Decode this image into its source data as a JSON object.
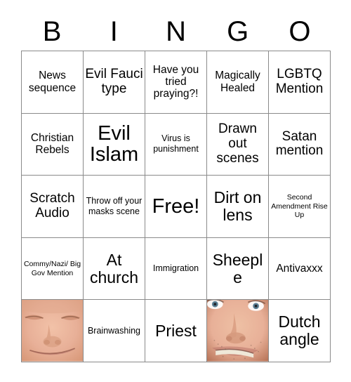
{
  "card": {
    "header_letters": [
      "B",
      "I",
      "N",
      "G",
      "O"
    ],
    "free_space_label": "Free!",
    "grid": [
      [
        {
          "text": "News sequence",
          "size": "md",
          "type": "text"
        },
        {
          "text": "Evil Fauci type",
          "size": "lg",
          "type": "text"
        },
        {
          "text": "Have you tried praying?!",
          "size": "md",
          "type": "text"
        },
        {
          "text": "Magically Healed",
          "size": "md",
          "type": "text"
        },
        {
          "text": "LGBTQ Mention",
          "size": "lg",
          "type": "text"
        }
      ],
      [
        {
          "text": "Christian Rebels",
          "size": "md",
          "type": "text"
        },
        {
          "text": "Evil Islam",
          "size": "xxl",
          "type": "text"
        },
        {
          "text": "Virus is punishment",
          "size": "sm",
          "type": "text"
        },
        {
          "text": "Drawn out scenes",
          "size": "lg",
          "type": "text"
        },
        {
          "text": "Satan mention",
          "size": "lg",
          "type": "text"
        }
      ],
      [
        {
          "text": "Scratch Audio",
          "size": "lg",
          "type": "text"
        },
        {
          "text": "Throw off your masks scene",
          "size": "sm",
          "type": "text"
        },
        {
          "text": "Free!",
          "size": "xxl",
          "type": "free"
        },
        {
          "text": "Dirt on lens",
          "size": "xl",
          "type": "text"
        },
        {
          "text": "Second Amendment Rise Up",
          "size": "xs",
          "type": "text"
        }
      ],
      [
        {
          "text": "Commy/Nazi/ Big Gov Mention",
          "size": "xs",
          "type": "text"
        },
        {
          "text": "At church",
          "size": "xl",
          "type": "text"
        },
        {
          "text": "Immigration",
          "size": "sm",
          "type": "text"
        },
        {
          "text": "Sheeple",
          "size": "xl",
          "type": "text"
        },
        {
          "text": "Antivaxxx",
          "size": "md",
          "type": "text"
        }
      ],
      [
        {
          "text": "",
          "size": "md",
          "type": "photo",
          "photo": "closed-eyes-smiling-face-photo"
        },
        {
          "text": "Brainwashing",
          "size": "sm",
          "type": "text"
        },
        {
          "text": "Priest",
          "size": "xl",
          "type": "text"
        },
        {
          "text": "",
          "size": "md",
          "type": "photo",
          "photo": "open-eyes-stubble-face-photo"
        },
        {
          "text": "Dutch angle",
          "size": "xl",
          "type": "text"
        }
      ]
    ],
    "colors": {
      "background": "#ffffff",
      "grid_line": "#8a8a8a",
      "text": "#000000",
      "skin_light": "#e8b098",
      "skin_mid": "#d89878",
      "skin_shadow": "#b9765a",
      "eye_blue": "#5a7f93",
      "teeth": "#efe8d8",
      "lip": "#b9746a"
    }
  }
}
